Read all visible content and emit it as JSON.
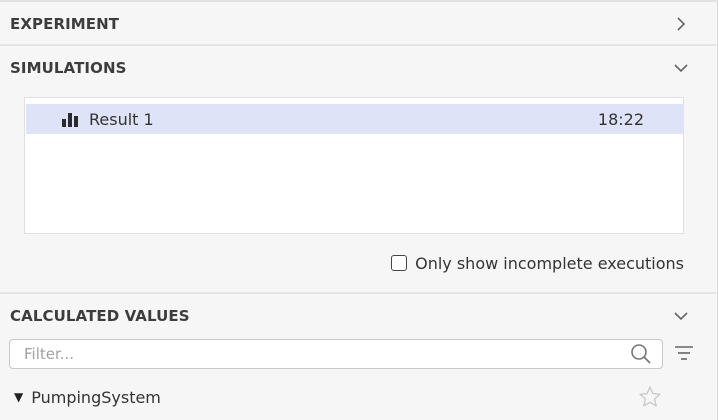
{
  "sections": {
    "experiment": {
      "title": "EXPERIMENT",
      "state": "collapsed"
    },
    "simulations": {
      "title": "SIMULATIONS",
      "state": "expanded"
    },
    "calculated_values": {
      "title": "CALCULATED VALUES",
      "state": "expanded"
    }
  },
  "simulations": {
    "items": [
      {
        "icon": "bar-chart-icon",
        "name": "Result 1",
        "time": "18:22",
        "selected": true
      }
    ],
    "incomplete_checkbox": {
      "label": "Only show incomplete executions",
      "checked": false
    }
  },
  "calculated_values": {
    "filter": {
      "placeholder": "Filter...",
      "value": ""
    },
    "tree": [
      {
        "label": "PumpingSystem",
        "expanded": true,
        "favorite": false
      }
    ]
  },
  "colors": {
    "selection": "#dfe3f7",
    "panel_bg": "#f6f6f6",
    "header_text": "#3d3d3d"
  }
}
